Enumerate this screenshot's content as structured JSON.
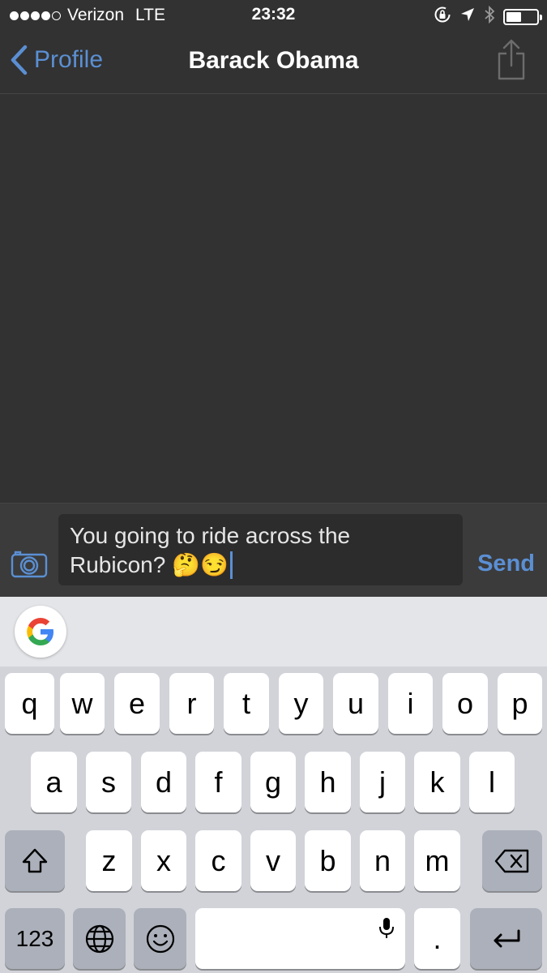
{
  "status_bar": {
    "carrier": "Verizon",
    "network": "LTE",
    "time": "23:32",
    "signal_bars_filled": 4,
    "signal_bars_total": 5,
    "battery_level": 0.5,
    "icons": [
      "rotation-lock-icon",
      "location-arrow-icon",
      "bluetooth-icon",
      "battery-icon"
    ]
  },
  "nav": {
    "back_label": "Profile",
    "title": "Barack Obama",
    "share_icon": "share-icon"
  },
  "composer": {
    "message_line1": "You going to ride across the",
    "message_line2": "Rubicon? 🤔😏",
    "send_label": "Send",
    "camera_icon": "camera-icon"
  },
  "keyboard": {
    "row1": [
      "q",
      "w",
      "e",
      "r",
      "t",
      "y",
      "u",
      "i",
      "o",
      "p"
    ],
    "row2": [
      "a",
      "s",
      "d",
      "f",
      "g",
      "h",
      "j",
      "k",
      "l"
    ],
    "row3": [
      "z",
      "x",
      "c",
      "v",
      "b",
      "n",
      "m"
    ],
    "numbers_label": "123",
    "period_label": ".",
    "google_icon": "google-g-icon"
  },
  "colors": {
    "accent": "#5b8fd3",
    "background": "#323232",
    "keyboard_bg": "#d1d3d9"
  }
}
